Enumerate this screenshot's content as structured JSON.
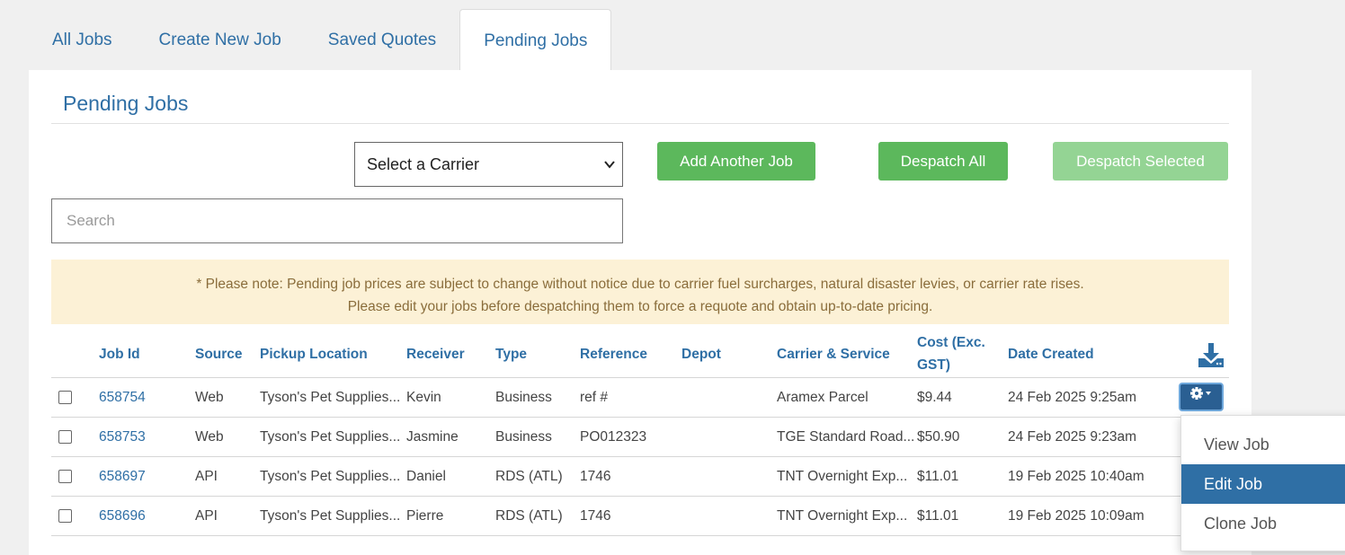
{
  "tabs": [
    "All Jobs",
    "Create New Job",
    "Saved Quotes",
    "Pending Jobs"
  ],
  "active_tab": "Pending Jobs",
  "page_title": "Pending Jobs",
  "carrier_select": {
    "value": "Select a Carrier"
  },
  "buttons": {
    "add_another": "Add Another Job",
    "despatch_all": "Despatch All",
    "despatch_selected": "Despatch Selected"
  },
  "search": {
    "placeholder": "Search"
  },
  "notice": {
    "line1": "* Please note: Pending job prices are subject to change without notice due to carrier fuel surcharges, natural disaster levies, or carrier rate rises.",
    "line2": "Please edit your jobs before despatching them to force a requote and obtain up-to-date pricing."
  },
  "table": {
    "headers": {
      "job_id": "Job Id",
      "source": "Source",
      "pickup": "Pickup Location",
      "receiver": "Receiver",
      "type": "Type",
      "reference": "Reference",
      "depot": "Depot",
      "carrier": "Carrier & Service",
      "cost": "Cost (Exc. GST)",
      "date": "Date Created"
    },
    "rows": [
      {
        "job_id": "658754",
        "source": "Web",
        "pickup": "Tyson's Pet Supplies...",
        "receiver": "Kevin",
        "type": "Business",
        "reference": "ref #",
        "depot": "",
        "carrier": "Aramex Parcel",
        "cost": "$9.44",
        "date": "24 Feb 2025 9:25am"
      },
      {
        "job_id": "658753",
        "source": "Web",
        "pickup": "Tyson's Pet Supplies...",
        "receiver": "Jasmine",
        "type": "Business",
        "reference": "PO012323",
        "depot": "",
        "carrier": "TGE Standard Road...",
        "cost": "$50.90",
        "date": "24 Feb 2025 9:23am"
      },
      {
        "job_id": "658697",
        "source": "API",
        "pickup": "Tyson's Pet Supplies...",
        "receiver": "Daniel",
        "type": "RDS (ATL)",
        "reference": "1746",
        "depot": "",
        "carrier": "TNT Overnight Exp...",
        "cost": "$11.01",
        "date": "19 Feb 2025 10:40am"
      },
      {
        "job_id": "658696",
        "source": "API",
        "pickup": "Tyson's Pet Supplies...",
        "receiver": "Pierre",
        "type": "RDS (ATL)",
        "reference": "1746",
        "depot": "",
        "carrier": "TNT Overnight Exp...",
        "cost": "$11.01",
        "date": "19 Feb 2025 10:09am"
      }
    ]
  },
  "actions_menu": {
    "items": [
      "View Job",
      "Edit Job",
      "Clone Job"
    ],
    "highlighted": "Edit Job"
  },
  "colors": {
    "link_blue": "#2f6fa5",
    "success_green": "#5cb85c",
    "notice_bg": "#fcf1d6"
  }
}
